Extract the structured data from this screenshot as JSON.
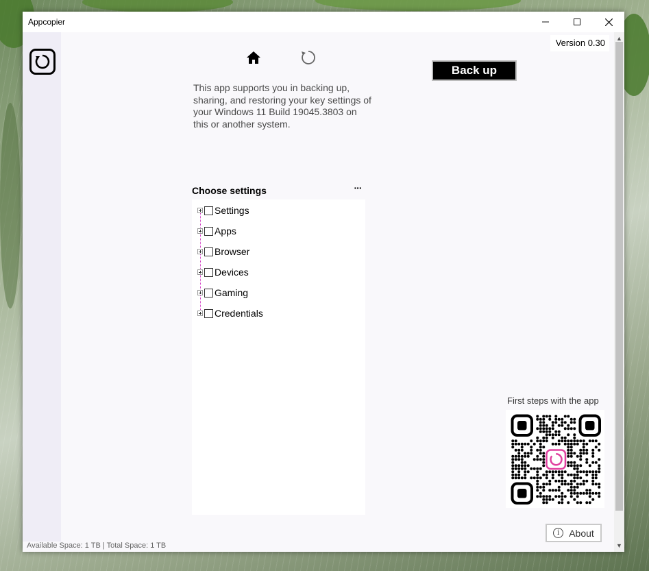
{
  "window": {
    "title": "Appcopier",
    "minimize_glyph": "—",
    "maximize_glyph": "☐",
    "close_glyph": "✕"
  },
  "header": {
    "version": "Version 0.30",
    "home_icon": "home-icon",
    "refresh_icon": "refresh-icon"
  },
  "description": "This app supports you in backing up, sharing, and restoring your key settings of your Windows 11 Build 19045.3803 on this or another system.",
  "backup_button": "Back up",
  "settings": {
    "title": "Choose settings",
    "more_label": "···",
    "items": [
      {
        "label": "Settings",
        "checked": false
      },
      {
        "label": "Apps",
        "checked": false
      },
      {
        "label": "Browser",
        "checked": false
      },
      {
        "label": "Devices",
        "checked": false
      },
      {
        "label": "Gaming",
        "checked": false
      },
      {
        "label": "Credentials",
        "checked": false
      }
    ]
  },
  "first_steps": "First steps with the app",
  "about_button": "About",
  "status": "Available Space: 1 TB | Total Space: 1 TB",
  "colors": {
    "accent": "#000000",
    "qr_logo": "#e040a0",
    "tree_line": "#d030c0"
  }
}
